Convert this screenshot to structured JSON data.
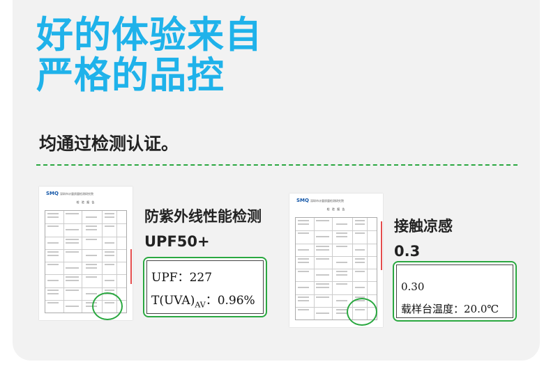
{
  "headline": {
    "line1": "好的体验来自",
    "line2": "严格的品控"
  },
  "subtitle": "均通过检测认证。",
  "report_logo": {
    "brand": "SMQ",
    "org": "深圳市计量质量检测研究院"
  },
  "report_title": "检 验 报 告",
  "uv_test": {
    "label": "防紫外线性能检测",
    "value": "UPF50+",
    "detail": {
      "upf_label": "UPF：",
      "upf_value": "227",
      "uva_label": "T(UVA)",
      "uva_sub": "AV",
      "uva_sep": "：",
      "uva_value": "0.96%"
    }
  },
  "cool_test": {
    "label": "接触凉感",
    "value": "0.3",
    "detail": {
      "reading": "0.30",
      "temp_label": "载样台温度：",
      "temp_value": "20.0℃"
    }
  },
  "colors": {
    "headline": "#1fb2ea",
    "accent": "#2aa840",
    "card": "#f2f2f2"
  }
}
